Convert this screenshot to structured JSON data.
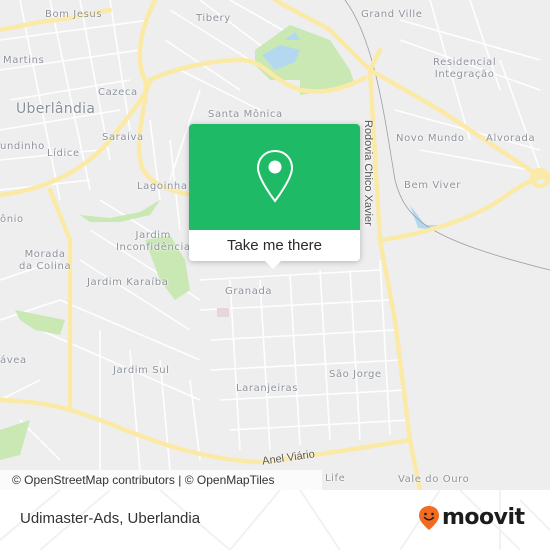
{
  "map": {
    "city_label": "Uberlândia",
    "places": [
      {
        "id": "bom-jesus",
        "label": "Bom Jesus"
      },
      {
        "id": "tibery",
        "label": "Tibery"
      },
      {
        "id": "grand-ville",
        "label": "Grand Ville"
      },
      {
        "id": "martins",
        "label": "Martins"
      },
      {
        "id": "residencial-integracao",
        "label": "Residencial\nIntegração"
      },
      {
        "id": "cazeca",
        "label": "Cazeca"
      },
      {
        "id": "santa-monica",
        "label": "Santa Mônica"
      },
      {
        "id": "saraiva",
        "label": "Saraiva"
      },
      {
        "id": "novo-mundo",
        "label": "Novo Mundo"
      },
      {
        "id": "alvorada",
        "label": "Alvorada"
      },
      {
        "id": "fundinho",
        "label": "undinho"
      },
      {
        "id": "lidice",
        "label": "Lídice"
      },
      {
        "id": "lagoinha",
        "label": "Lagoinha"
      },
      {
        "id": "bem-viver",
        "label": "Bem Viver"
      },
      {
        "id": "patrimonio",
        "label": "ônio"
      },
      {
        "id": "jardim-inconfidencia",
        "label": "Jardim\nInconfidência"
      },
      {
        "id": "morada-da-colina",
        "label": "Morada\nda Colina"
      },
      {
        "id": "jardim-karaiba",
        "label": "Jardim Karaíba"
      },
      {
        "id": "granada",
        "label": "Granada"
      },
      {
        "id": "gavea",
        "label": "ávea"
      },
      {
        "id": "jardim-sul",
        "label": "Jardim Sul"
      },
      {
        "id": "sao-jorge",
        "label": "São Jorge"
      },
      {
        "id": "laranjeiras",
        "label": "Laranjeiras"
      },
      {
        "id": "life",
        "label": "Life"
      },
      {
        "id": "vale-do-ouro",
        "label": "Vale do Ouro"
      }
    ],
    "roads": {
      "rodovia": "Rodovia Chico Xavier",
      "anel": "Anel Viário"
    },
    "colors": {
      "background": "#eeeeef",
      "road_major": "#fbe9a6",
      "road_minor": "#ffffff",
      "park": "#c9e8b4",
      "water": "#b3d8f0"
    }
  },
  "popup": {
    "icon": "map-pin-icon",
    "button_label": "Take me there",
    "accent_color": "#1fba66"
  },
  "attribution": {
    "osm": "© OpenStreetMap contributors",
    "separator": " | ",
    "omt": "© OpenMapTiles"
  },
  "footer": {
    "title": "Udimaster-Ads, Uberlandia",
    "brand": "moovit",
    "brand_icon": "moovit-smiley-pin-icon",
    "brand_color": "#f26b21"
  }
}
